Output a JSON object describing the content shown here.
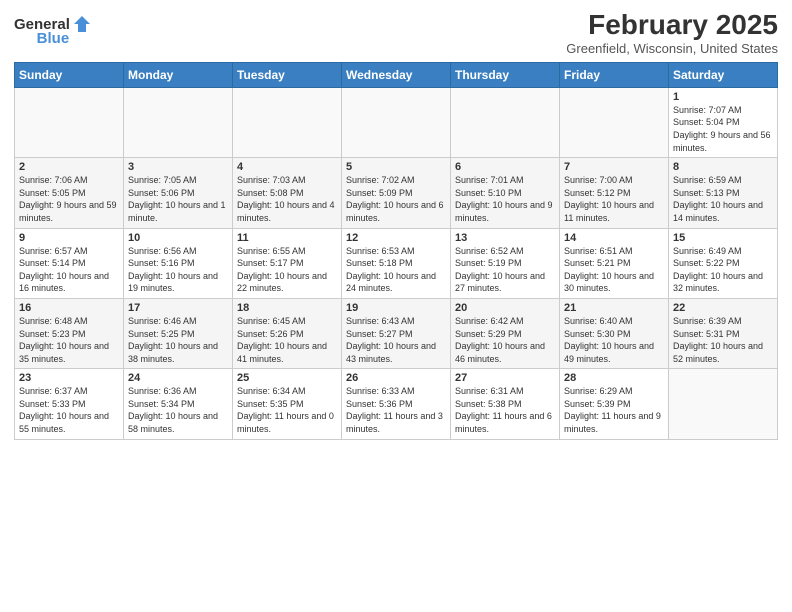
{
  "header": {
    "logo_general": "General",
    "logo_blue": "Blue",
    "title": "February 2025",
    "subtitle": "Greenfield, Wisconsin, United States"
  },
  "days_of_week": [
    "Sunday",
    "Monday",
    "Tuesday",
    "Wednesday",
    "Thursday",
    "Friday",
    "Saturday"
  ],
  "weeks": [
    [
      {
        "day": "",
        "info": ""
      },
      {
        "day": "",
        "info": ""
      },
      {
        "day": "",
        "info": ""
      },
      {
        "day": "",
        "info": ""
      },
      {
        "day": "",
        "info": ""
      },
      {
        "day": "",
        "info": ""
      },
      {
        "day": "1",
        "info": "Sunrise: 7:07 AM\nSunset: 5:04 PM\nDaylight: 9 hours and 56 minutes."
      }
    ],
    [
      {
        "day": "2",
        "info": "Sunrise: 7:06 AM\nSunset: 5:05 PM\nDaylight: 9 hours and 59 minutes."
      },
      {
        "day": "3",
        "info": "Sunrise: 7:05 AM\nSunset: 5:06 PM\nDaylight: 10 hours and 1 minute."
      },
      {
        "day": "4",
        "info": "Sunrise: 7:03 AM\nSunset: 5:08 PM\nDaylight: 10 hours and 4 minutes."
      },
      {
        "day": "5",
        "info": "Sunrise: 7:02 AM\nSunset: 5:09 PM\nDaylight: 10 hours and 6 minutes."
      },
      {
        "day": "6",
        "info": "Sunrise: 7:01 AM\nSunset: 5:10 PM\nDaylight: 10 hours and 9 minutes."
      },
      {
        "day": "7",
        "info": "Sunrise: 7:00 AM\nSunset: 5:12 PM\nDaylight: 10 hours and 11 minutes."
      },
      {
        "day": "8",
        "info": "Sunrise: 6:59 AM\nSunset: 5:13 PM\nDaylight: 10 hours and 14 minutes."
      }
    ],
    [
      {
        "day": "9",
        "info": "Sunrise: 6:57 AM\nSunset: 5:14 PM\nDaylight: 10 hours and 16 minutes."
      },
      {
        "day": "10",
        "info": "Sunrise: 6:56 AM\nSunset: 5:16 PM\nDaylight: 10 hours and 19 minutes."
      },
      {
        "day": "11",
        "info": "Sunrise: 6:55 AM\nSunset: 5:17 PM\nDaylight: 10 hours and 22 minutes."
      },
      {
        "day": "12",
        "info": "Sunrise: 6:53 AM\nSunset: 5:18 PM\nDaylight: 10 hours and 24 minutes."
      },
      {
        "day": "13",
        "info": "Sunrise: 6:52 AM\nSunset: 5:19 PM\nDaylight: 10 hours and 27 minutes."
      },
      {
        "day": "14",
        "info": "Sunrise: 6:51 AM\nSunset: 5:21 PM\nDaylight: 10 hours and 30 minutes."
      },
      {
        "day": "15",
        "info": "Sunrise: 6:49 AM\nSunset: 5:22 PM\nDaylight: 10 hours and 32 minutes."
      }
    ],
    [
      {
        "day": "16",
        "info": "Sunrise: 6:48 AM\nSunset: 5:23 PM\nDaylight: 10 hours and 35 minutes."
      },
      {
        "day": "17",
        "info": "Sunrise: 6:46 AM\nSunset: 5:25 PM\nDaylight: 10 hours and 38 minutes."
      },
      {
        "day": "18",
        "info": "Sunrise: 6:45 AM\nSunset: 5:26 PM\nDaylight: 10 hours and 41 minutes."
      },
      {
        "day": "19",
        "info": "Sunrise: 6:43 AM\nSunset: 5:27 PM\nDaylight: 10 hours and 43 minutes."
      },
      {
        "day": "20",
        "info": "Sunrise: 6:42 AM\nSunset: 5:29 PM\nDaylight: 10 hours and 46 minutes."
      },
      {
        "day": "21",
        "info": "Sunrise: 6:40 AM\nSunset: 5:30 PM\nDaylight: 10 hours and 49 minutes."
      },
      {
        "day": "22",
        "info": "Sunrise: 6:39 AM\nSunset: 5:31 PM\nDaylight: 10 hours and 52 minutes."
      }
    ],
    [
      {
        "day": "23",
        "info": "Sunrise: 6:37 AM\nSunset: 5:33 PM\nDaylight: 10 hours and 55 minutes."
      },
      {
        "day": "24",
        "info": "Sunrise: 6:36 AM\nSunset: 5:34 PM\nDaylight: 10 hours and 58 minutes."
      },
      {
        "day": "25",
        "info": "Sunrise: 6:34 AM\nSunset: 5:35 PM\nDaylight: 11 hours and 0 minutes."
      },
      {
        "day": "26",
        "info": "Sunrise: 6:33 AM\nSunset: 5:36 PM\nDaylight: 11 hours and 3 minutes."
      },
      {
        "day": "27",
        "info": "Sunrise: 6:31 AM\nSunset: 5:38 PM\nDaylight: 11 hours and 6 minutes."
      },
      {
        "day": "28",
        "info": "Sunrise: 6:29 AM\nSunset: 5:39 PM\nDaylight: 11 hours and 9 minutes."
      },
      {
        "day": "",
        "info": ""
      }
    ]
  ]
}
